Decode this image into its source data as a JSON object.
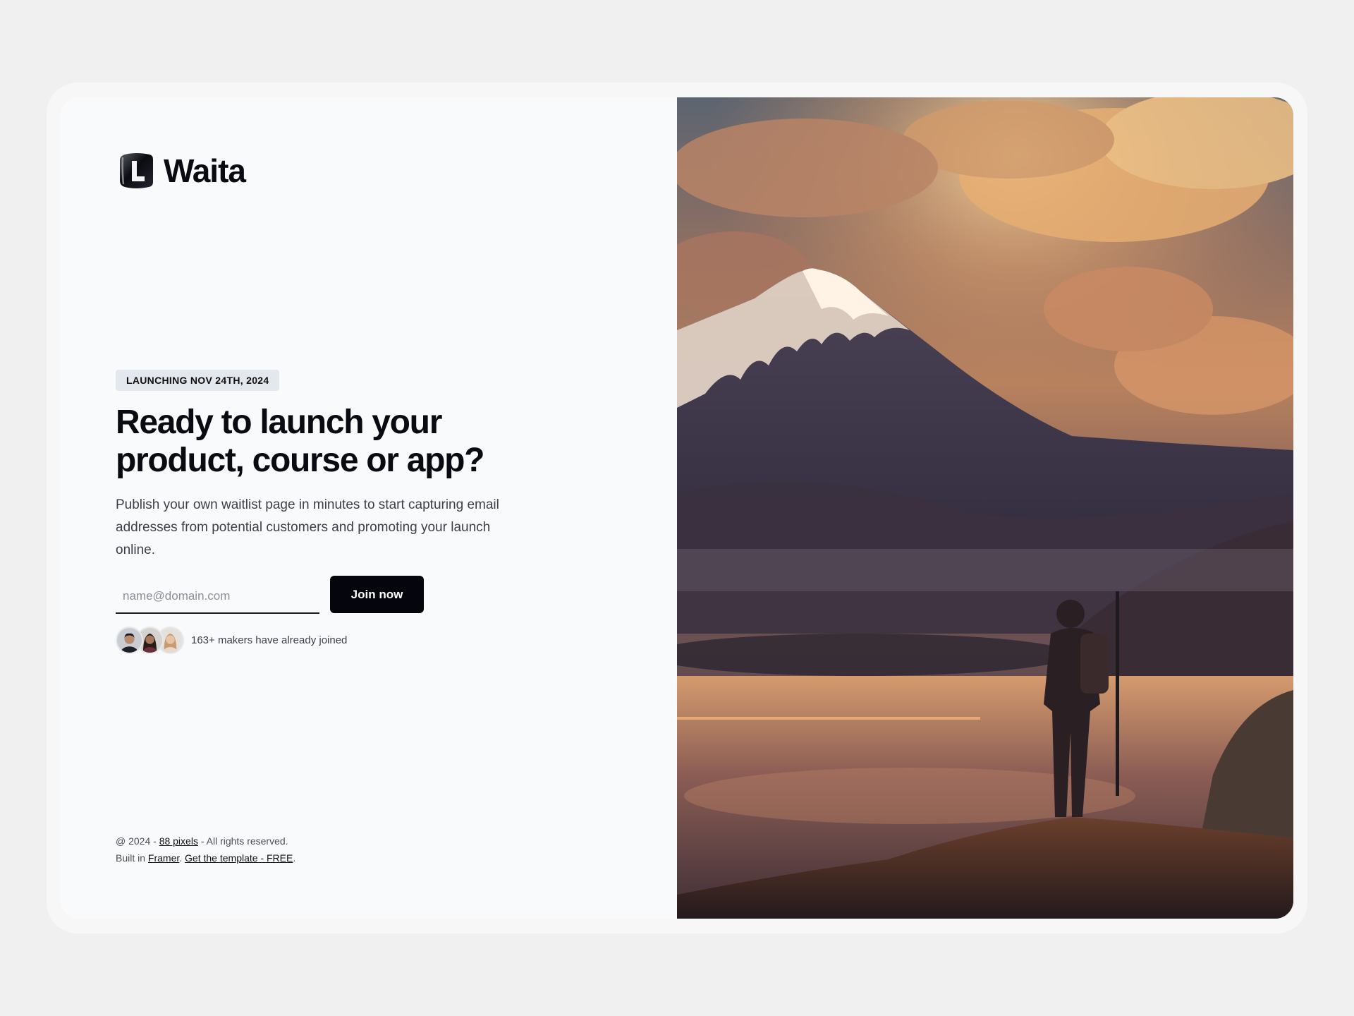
{
  "brand": {
    "name": "Waita"
  },
  "hero": {
    "badge": "LAUNCHING NOV 24TH, 2024",
    "headline_line1": "Ready to launch your",
    "headline_line2": "product, course or app?",
    "description": "Publish your own waitlist page in minutes to start capturing email addresses from potential customers and promoting your launch online."
  },
  "form": {
    "email_placeholder": "name@domain.com",
    "email_value": "",
    "submit_label": "Join now"
  },
  "social_proof": {
    "joined_text": "163+ makers have already joined"
  },
  "footer": {
    "copyright_prefix": "@ 2024 - ",
    "author_link": "88 pixels",
    "copyright_suffix": " - All rights reserved.",
    "built_prefix": "Built in ",
    "framer_link": "Framer",
    "separator": ". ",
    "template_link": "Get the template - FREE",
    "end": "."
  },
  "colors": {
    "page_bg": "#f0f0f1",
    "panel_bg": "#f9fafb",
    "badge_bg": "#e3e7ee",
    "button_bg": "#05060d",
    "text_primary": "#0a0b12"
  },
  "icons": {
    "logo": "waita-logo-icon"
  }
}
